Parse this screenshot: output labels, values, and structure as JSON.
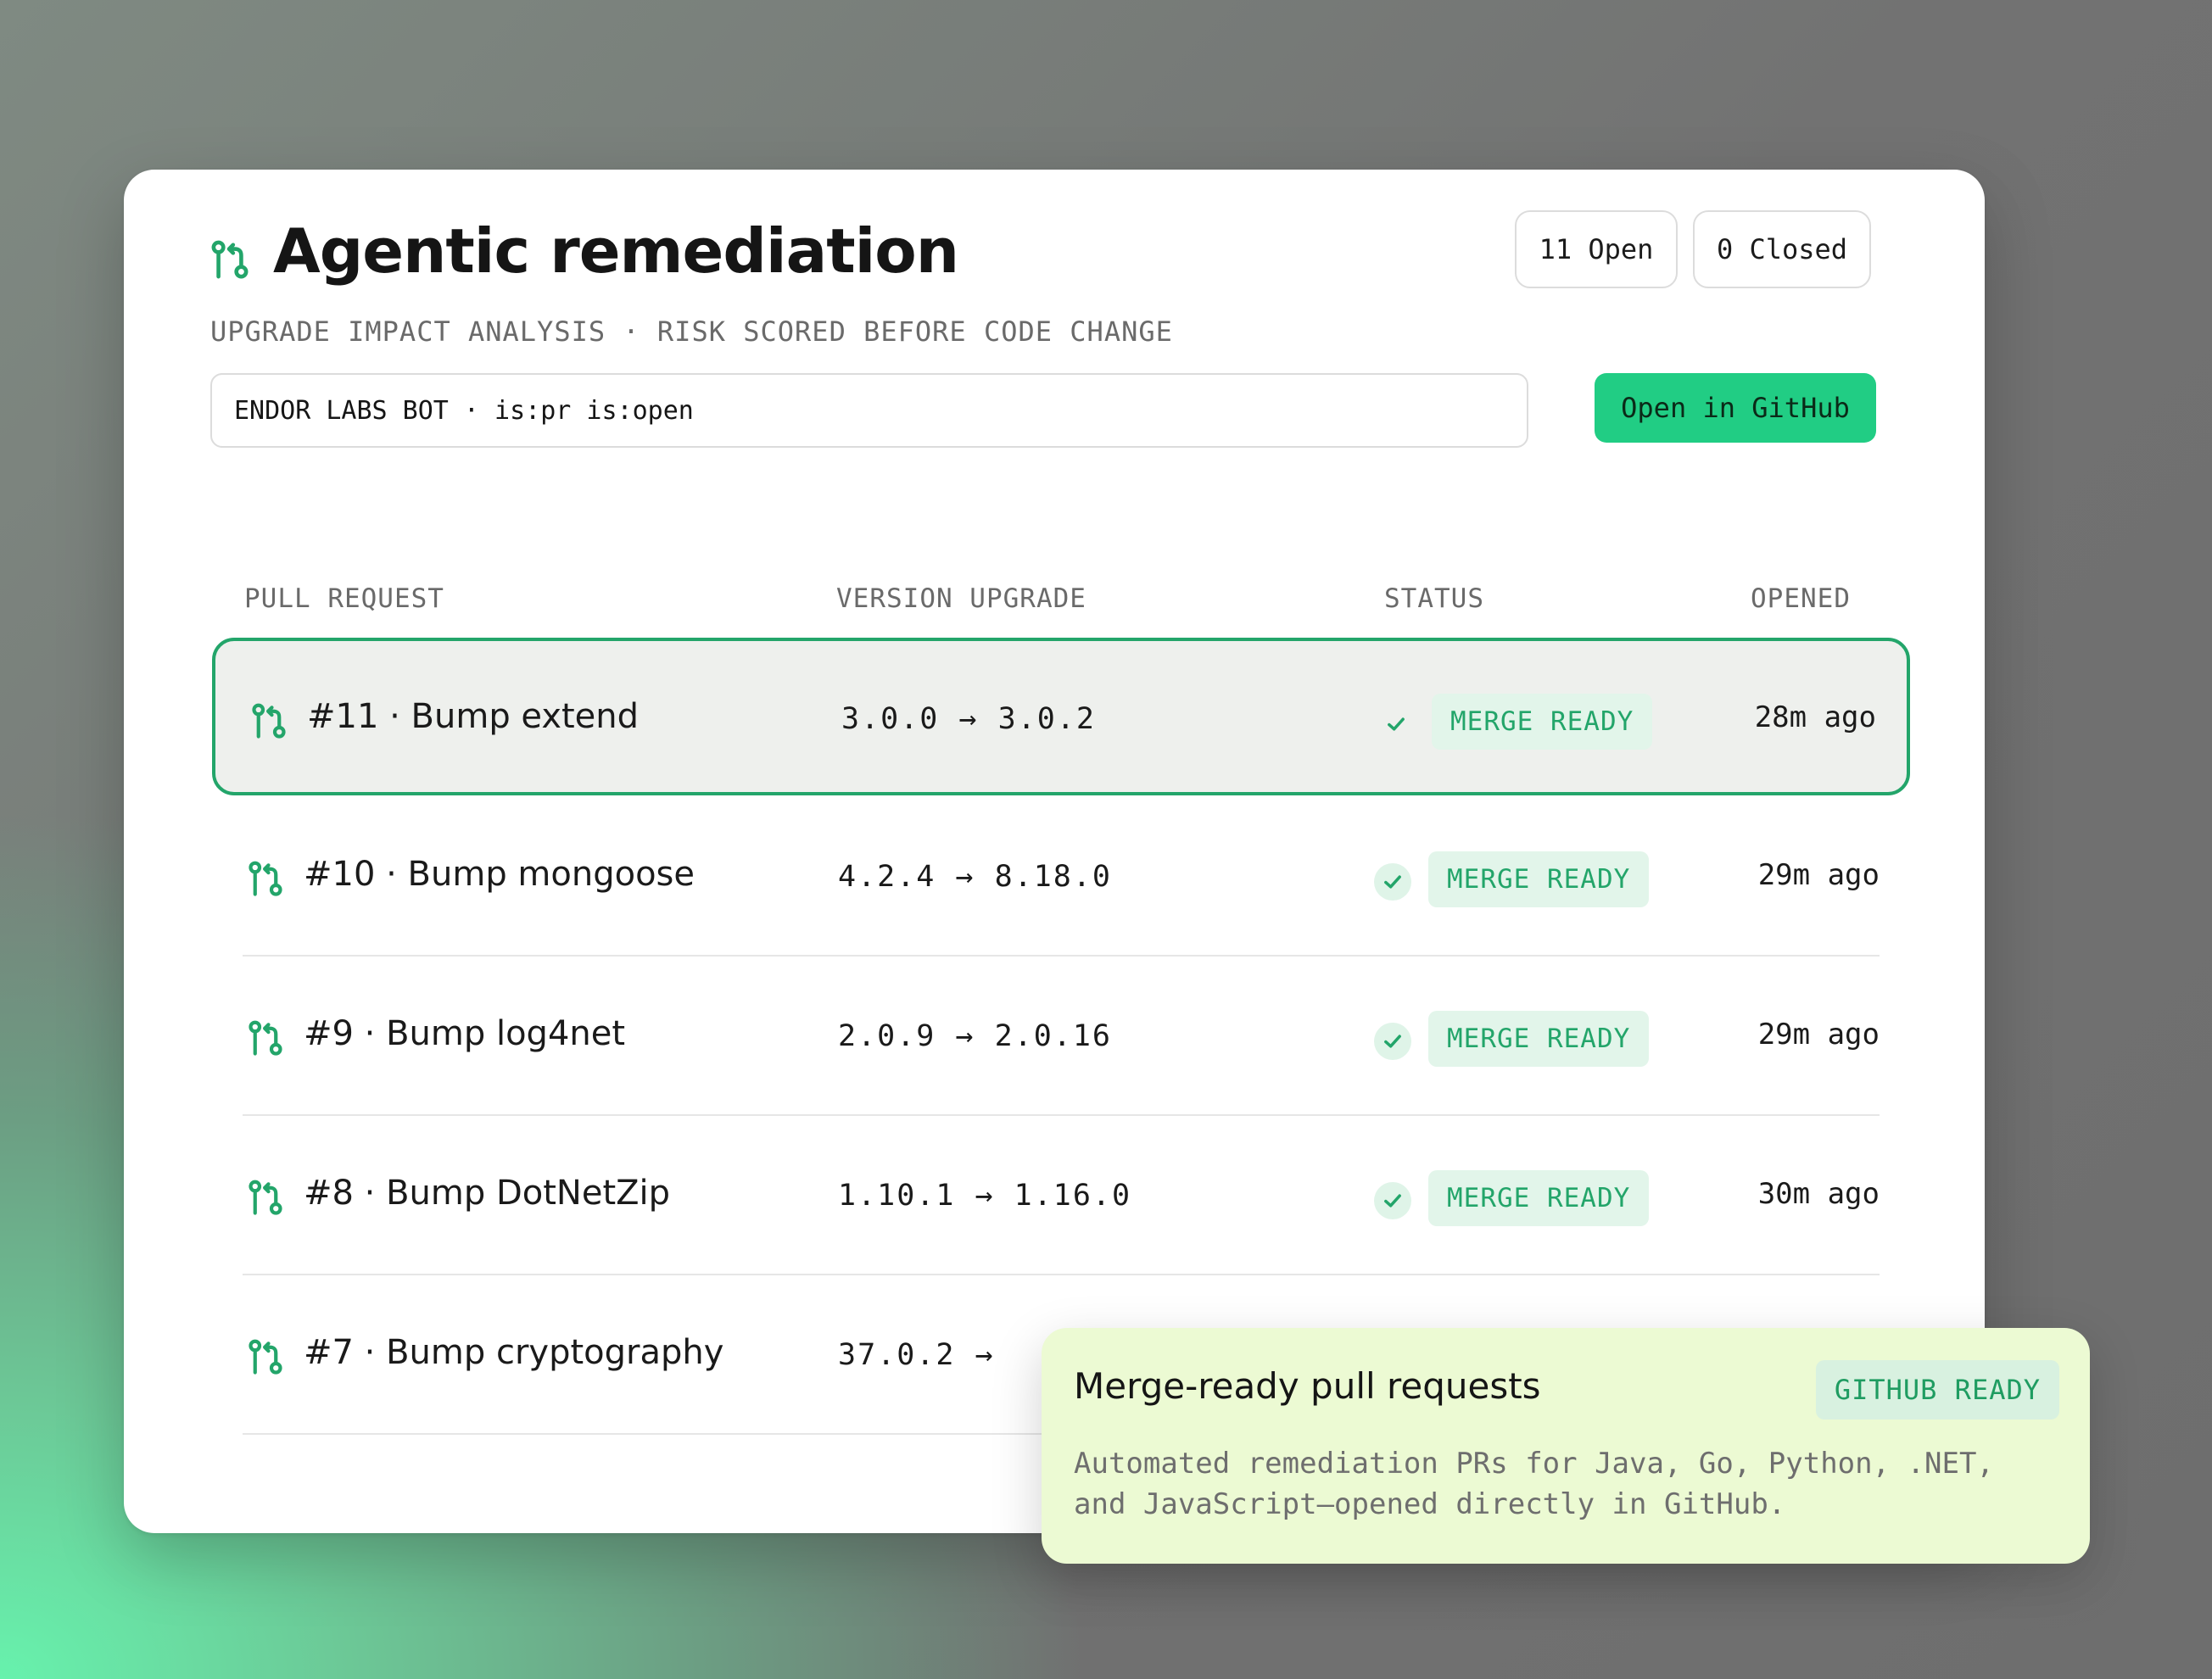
{
  "colors": {
    "accent": "#23a56a",
    "button": "#21cd84",
    "callout_bg": "#ecfad3",
    "badge_bg": "#e2f5ea"
  },
  "header": {
    "icon": "git-pull-request-icon",
    "title": "Agentic remediation",
    "subtitle": "UPGRADE IMPACT ANALYSIS · RISK SCORED BEFORE CODE CHANGE",
    "open_count_label": "11 Open",
    "closed_count_label": "0 Closed"
  },
  "search": {
    "value": "ENDOR LABS BOT · is:pr is:open"
  },
  "actions": {
    "open_github_label": "Open in GitHub"
  },
  "table": {
    "columns": [
      "PULL REQUEST",
      "VERSION UPGRADE",
      "STATUS",
      "OPENED"
    ],
    "rows": [
      {
        "title": "#11 · Bump extend",
        "version": "3.0.0 → 3.0.2",
        "status": "MERGE READY",
        "opened": "28m ago",
        "selected": true
      },
      {
        "title": "#10 · Bump mongoose",
        "version": "4.2.4 → 8.18.0",
        "status": "MERGE READY",
        "opened": "29m ago",
        "selected": false
      },
      {
        "title": "#9 · Bump log4net",
        "version": "2.0.9 → 2.0.16",
        "status": "MERGE READY",
        "opened": "29m ago",
        "selected": false
      },
      {
        "title": "#8 · Bump DotNetZip",
        "version": "1.10.1 → 1.16.0",
        "status": "MERGE READY",
        "opened": "30m ago",
        "selected": false
      },
      {
        "title": "#7 · Bump cryptography",
        "version": "37.0.2 →",
        "status": "",
        "opened": "",
        "selected": false
      }
    ]
  },
  "callout": {
    "title": "Merge-ready pull requests",
    "badge": "GITHUB READY",
    "text": "Automated remediation PRs for Java, Go, Python, .NET, and JavaScript—opened directly in GitHub."
  }
}
